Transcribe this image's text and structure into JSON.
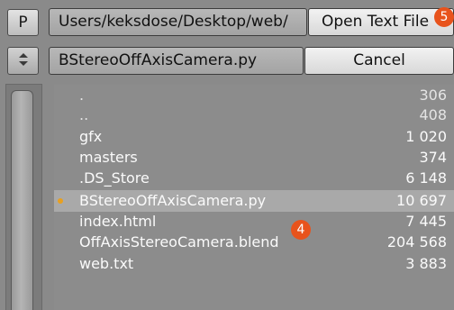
{
  "toolbar": {
    "p_label": "P",
    "sort_icon": "updown-arrows-icon"
  },
  "path": {
    "directory": "Users/keksdose/Desktop/web/",
    "filename": "BStereoOffAxisCamera.py"
  },
  "actions": {
    "open_label": "Open Text File",
    "cancel_label": "Cancel"
  },
  "annotations": {
    "badge_open": "5",
    "badge_file": "4",
    "badge_color": "#e8531c"
  },
  "files": [
    {
      "name": ".",
      "size": "306"
    },
    {
      "name": "..",
      "size": "408"
    },
    {
      "name": "gfx",
      "size": "1 020"
    },
    {
      "name": "masters",
      "size": "374"
    },
    {
      "name": ".DS_Store",
      "size": "6 148"
    },
    {
      "name": "BStereoOffAxisCamera.py",
      "size": "10 697",
      "selected": true
    },
    {
      "name": "index.html",
      "size": "7 445"
    },
    {
      "name": "OffAxisStereoCamera.blend",
      "size": "204 568"
    },
    {
      "name": "web.txt",
      "size": "3 883"
    }
  ],
  "colors": {
    "selected_dot": "#e8a020",
    "list_bg": "#8c8c8c",
    "selected_bg": "#a9a9a9"
  }
}
